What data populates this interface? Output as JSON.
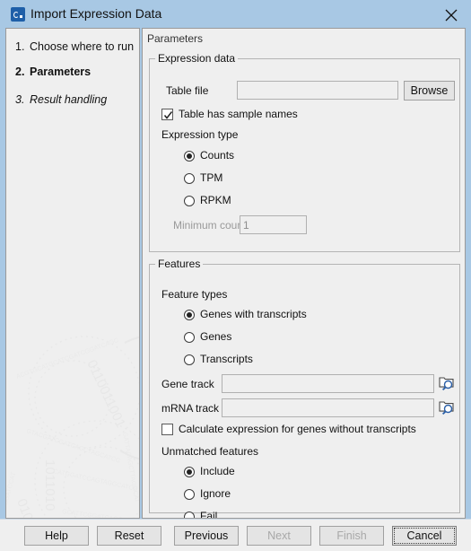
{
  "window": {
    "title": "Import Expression Data",
    "icon": "app-icon",
    "close_icon": "close-icon"
  },
  "sidebar": {
    "steps": [
      {
        "num": "1.",
        "label": "Choose where to run",
        "state": "normal"
      },
      {
        "num": "2.",
        "label": "Parameters",
        "state": "current"
      },
      {
        "num": "3.",
        "label": "Result handling",
        "state": "pending"
      }
    ],
    "watermark": "decorative-binary-spiral"
  },
  "content": {
    "header": "Parameters",
    "expression_data": {
      "legend": "Expression data",
      "table_file": {
        "label": "Table file",
        "value": "",
        "placeholder": ""
      },
      "browse_label": "Browse",
      "sample_names": {
        "label": "Table has sample names",
        "checked": true
      },
      "expression_type": {
        "label": "Expression type",
        "options": [
          "Counts",
          "TPM",
          "RPKM"
        ],
        "selected": "Counts"
      },
      "minimum_count": {
        "label": "Minimum count",
        "value": "1",
        "enabled": false
      }
    },
    "features": {
      "legend": "Features",
      "feature_types": {
        "label": "Feature types",
        "options": [
          "Genes with transcripts",
          "Genes",
          "Transcripts"
        ],
        "selected": "Genes with transcripts"
      },
      "gene_track": {
        "label": "Gene track",
        "value": "",
        "browse_icon": "folder-search-icon"
      },
      "mrna_track": {
        "label": "mRNA track",
        "value": "",
        "browse_icon": "folder-search-icon"
      },
      "calculate_without_transcripts": {
        "label": "Calculate expression for genes without transcripts",
        "checked": false
      },
      "unmatched_features": {
        "label": "Unmatched features",
        "options": [
          "Include",
          "Ignore",
          "Fail"
        ],
        "selected": "Include"
      }
    }
  },
  "buttons": {
    "help": "Help",
    "reset": "Reset",
    "previous": "Previous",
    "next": "Next",
    "finish": "Finish",
    "cancel": "Cancel",
    "next_enabled": false,
    "finish_enabled": false,
    "focused": "Cancel"
  },
  "colors": {
    "titlebar": "#a8c8e4",
    "panel": "#efefef",
    "accent": "#1f5fa8",
    "border": "#9a9a9a",
    "disabled_text": "#a6a6a6"
  }
}
